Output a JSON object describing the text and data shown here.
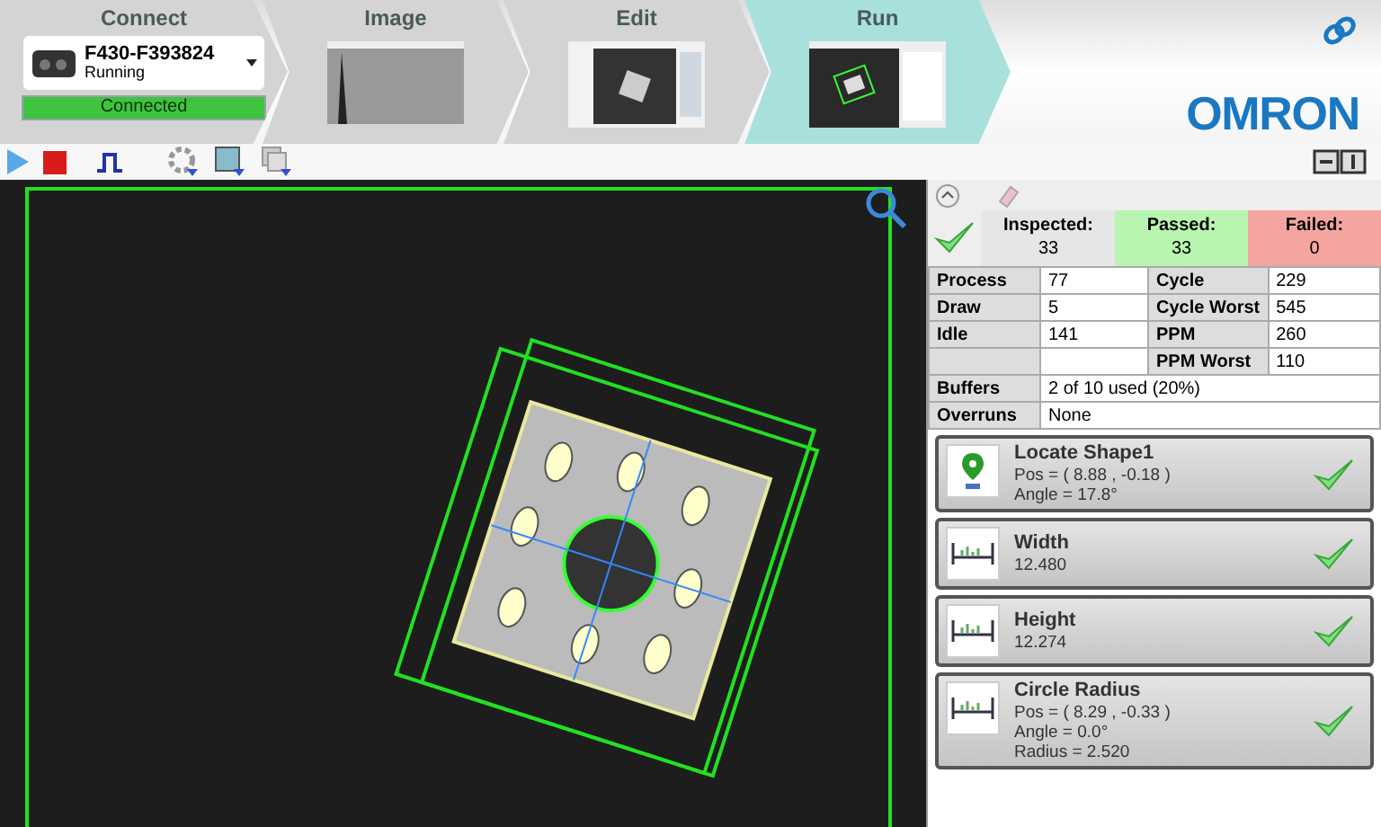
{
  "steps": [
    {
      "label": "Connect",
      "kind": "device",
      "selected": false
    },
    {
      "label": "Image",
      "kind": "histogram",
      "selected": false
    },
    {
      "label": "Edit",
      "kind": "edit",
      "selected": false
    },
    {
      "label": "Run",
      "kind": "run",
      "selected": true
    }
  ],
  "device": {
    "name": "F430-F393824",
    "status": "Running",
    "connection": "Connected"
  },
  "brand": "OMRON",
  "results": {
    "overall_pass": true,
    "counters": [
      {
        "label": "Inspected:",
        "value": "33",
        "kind": "neutral"
      },
      {
        "label": "Passed:",
        "value": "33",
        "kind": "pass"
      },
      {
        "label": "Failed:",
        "value": "0",
        "kind": "fail"
      }
    ],
    "timing": [
      {
        "label": "Process",
        "value": "77",
        "label_2": "Cycle",
        "value_2": "229"
      },
      {
        "label": "Draw",
        "value": "5",
        "label_2": "Cycle Worst",
        "value_2": "545"
      },
      {
        "label": "Idle",
        "value": "141",
        "label_2": "PPM",
        "value_2": "260"
      },
      {
        "label_2": "PPM Worst",
        "value_2": "110"
      }
    ],
    "summary": [
      {
        "label": "Buffers",
        "value": "2 of 10 used (20%)"
      },
      {
        "label": "Overruns",
        "value": "None"
      }
    ]
  },
  "tools": [
    {
      "name": "Locate Shape1",
      "kind": "locate",
      "passed": true,
      "lines": [
        "Pos = ( 8.88 , -0.18 )",
        "Angle = 17.8°"
      ]
    },
    {
      "name": "Width",
      "kind": "measure",
      "passed": true,
      "lines": [
        "12.480"
      ]
    },
    {
      "name": "Height",
      "kind": "measure",
      "passed": true,
      "lines": [
        "12.274"
      ]
    },
    {
      "name": "Circle Radius",
      "kind": "measure",
      "passed": true,
      "lines": [
        "Pos = ( 8.29 , -0.33 )",
        "Angle = 0.0°",
        "Radius = 2.520"
      ]
    }
  ]
}
